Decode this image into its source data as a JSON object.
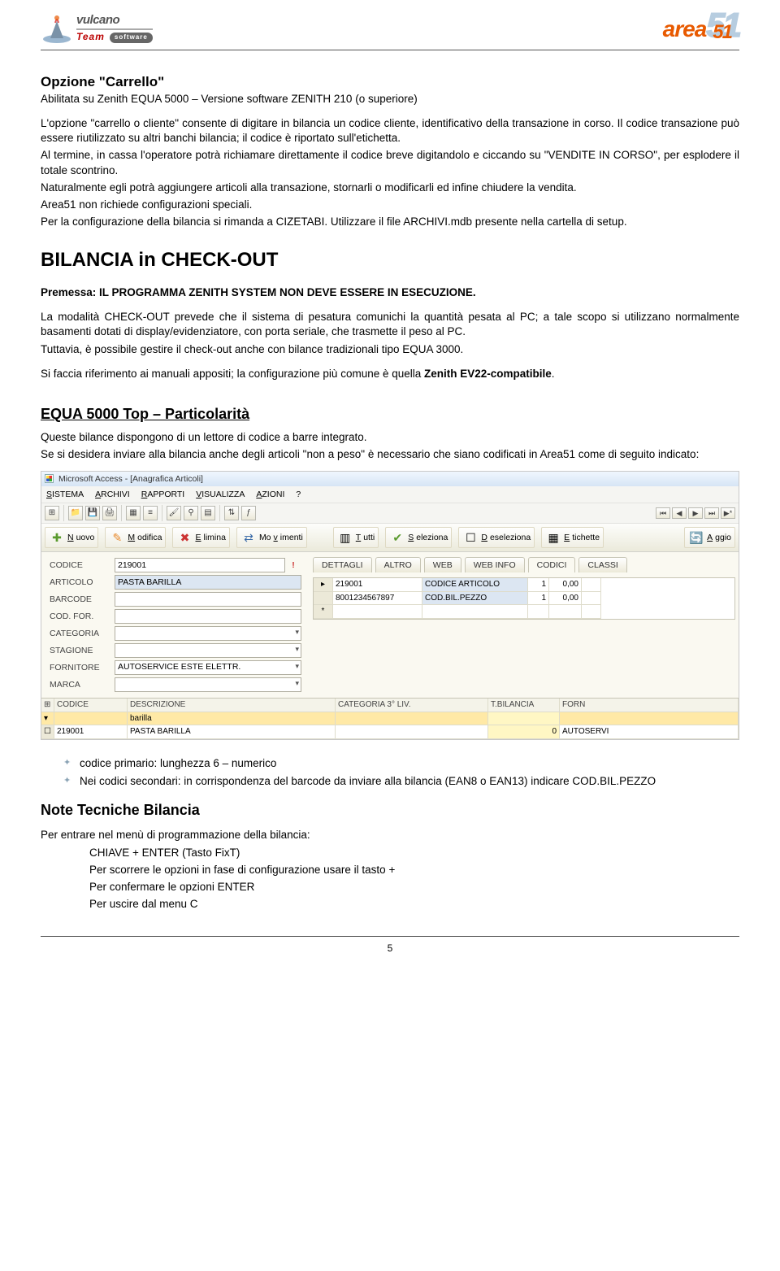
{
  "logos": {
    "left_line1": "vulcano",
    "left_line2": "Team",
    "left_badge": "software",
    "right_area": "area",
    "right_outline": "51",
    "right_inner": "51"
  },
  "section1": {
    "heading": "Opzione \"Carrello\"",
    "sub": "Abilitata su Zenith EQUA 5000 – Versione software ZENITH 210 (o superiore)",
    "p1": "L'opzione \"carrello o cliente\" consente di digitare in bilancia un codice cliente, identificativo della transazione in corso. Il codice transazione può essere riutilizzato su altri banchi bilancia; il codice è riportato sull'etichetta.",
    "p2": "Al termine, in cassa l'operatore potrà richiamare direttamente il codice breve digitandolo e ciccando su \"VENDITE IN CORSO\", per esplodere il totale scontrino.",
    "p3": "Naturalmente egli potrà aggiungere articoli alla transazione, stornarli o modificarli ed infine chiudere la vendita.",
    "p4": "Area51 non richiede configurazioni speciali.",
    "p5": "Per la configurazione della bilancia si rimanda a CIZETABI. Utilizzare il file ARCHIVI.mdb presente nella cartella di setup."
  },
  "section2": {
    "heading": "BILANCIA in CHECK-OUT",
    "premessa": "Premessa: IL PROGRAMMA ZENITH SYSTEM NON DEVE ESSERE IN ESECUZIONE.",
    "p1": "La modalità CHECK-OUT prevede che il sistema di pesatura comunichi la quantità pesata al PC; a tale scopo si utilizzano normalmente basamenti dotati di display/evidenziatore, con porta seriale, che trasmette il peso al PC.",
    "p2": "Tuttavia, è possibile gestire il check-out anche con bilance tradizionali tipo EQUA 3000.",
    "p_ref_pre": "Si faccia riferimento ai manuali appositi; la configurazione più comune è quella ",
    "p_ref_bold": "Zenith EV22-compatibile",
    "p_ref_post": "."
  },
  "section3": {
    "heading": "EQUA 5000 Top – Particolarità",
    "p1": "Queste bilance dispongono di un lettore di codice a barre integrato.",
    "p2": "Se si desidera inviare alla bilancia anche degli articoli \"non a peso\" è necessario che siano codificati in Area51 come di seguito indicato:"
  },
  "app": {
    "title": "Microsoft Access - [Anagrafica Articoli]",
    "menu": {
      "sistema": "SISTEMA",
      "archivi": "ARCHIVI",
      "rapporti": "RAPPORTI",
      "visualizza": "VISUALIZZA",
      "azioni": "AZIONI",
      "help": "?"
    },
    "actions": {
      "nuovo": "Nuovo",
      "modifica": "Modifica",
      "elimina": "Elimina",
      "movimenti": "Movimenti",
      "tutti": "Tutti",
      "seleziona": "Seleziona",
      "deseleziona": "Deseleziona",
      "etichette": "Etichette",
      "aggio": "Aggio"
    },
    "labels": {
      "codice": "CODICE",
      "articolo": "ARTICOLO",
      "barcode": "BARCODE",
      "codfor": "COD. FOR.",
      "categoria": "CATEGORIA",
      "stagione": "STAGIONE",
      "fornitore": "FORNITORE",
      "marca": "MARCA"
    },
    "values": {
      "codice": "219001",
      "articolo": "PASTA BARILLA",
      "barcode": "",
      "fornitore": "AUTOSERVICE ESTE ELETTR."
    },
    "tabs": {
      "dettagli": "DETTAGLI",
      "altro": "ALTRO",
      "web": "WEB",
      "webinfo": "WEB INFO",
      "codici": "CODICI",
      "classi": "CLASSI"
    },
    "subgrid": {
      "r1": {
        "code": "219001",
        "desc": "CODICE ARTICOLO",
        "q": "1",
        "p": "0,00"
      },
      "r2": {
        "code": "8001234567897",
        "desc": "COD.BIL.PEZZO",
        "q": "1",
        "p": "0,00"
      }
    },
    "maingrid": {
      "h": {
        "codice": "CODICE",
        "descr": "DESCRIZIONE",
        "cat": "CATEGORIA 3° LIV.",
        "tbil": "T.BILANCIA",
        "forn": "FORN"
      },
      "filter": {
        "descr": "barilla"
      },
      "row": {
        "codice": "219001",
        "descr": "PASTA BARILLA",
        "cat": "",
        "tbil": "0",
        "forn": "AUTOSERVI"
      }
    }
  },
  "bullets": {
    "b1": "codice primario: lunghezza 6 – numerico",
    "b2": "Nei codici secondari: in corrispondenza del barcode da inviare alla bilancia (EAN8 o EAN13) indicare COD.BIL.PEZZO"
  },
  "notes": {
    "heading": "Note Tecniche Bilancia",
    "p1": "Per entrare nel menù di programmazione della bilancia:",
    "l1": "CHIAVE + ENTER  (Tasto FixT)",
    "l2": "Per scorrere le opzioni in fase di configurazione usare il tasto +",
    "l3": "Per confermare le opzioni ENTER",
    "l4": "Per uscire dal menu C"
  },
  "page_number": "5"
}
